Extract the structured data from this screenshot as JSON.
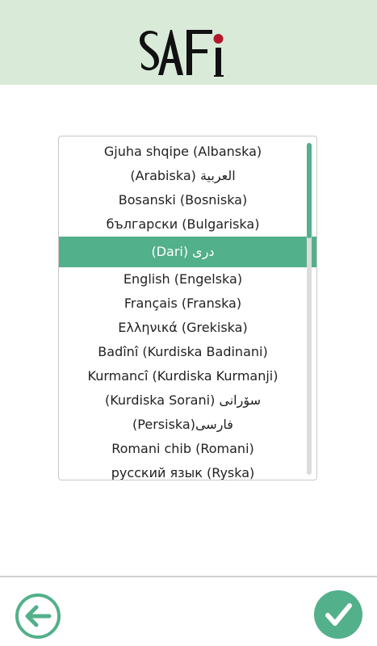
{
  "header": {
    "logo_text": "SAFi",
    "background": "#d9ead9"
  },
  "language_list": {
    "selected_index": 4,
    "accent_color": "#52b08a",
    "scroll_position_fraction": 0.0,
    "items": [
      {
        "label": "Gjuha shqipe (Albanska)"
      },
      {
        "label": "العربية (Arabiska)"
      },
      {
        "label": "Bosanski (Bosniska)"
      },
      {
        "label": "български (Bulgariska)"
      },
      {
        "label": "دری (Dari)"
      },
      {
        "label": "English (Engelska)"
      },
      {
        "label": "Français (Franska)"
      },
      {
        "label": "Ελληνικά (Grekiska)"
      },
      {
        "label": "Badînî (Kurdiska Badinani)"
      },
      {
        "label": "Kurmancî (Kurdiska Kurmanji)"
      },
      {
        "label": "سۆرانی (Kurdiska Sorani)"
      },
      {
        "label": "فارسی(Persiska)"
      },
      {
        "label": "Romani chib (Romani)"
      },
      {
        "label": "русский язык (Ryska)"
      }
    ]
  },
  "footer": {
    "back_icon": "arrow-left-icon",
    "confirm_icon": "checkmark-icon"
  }
}
